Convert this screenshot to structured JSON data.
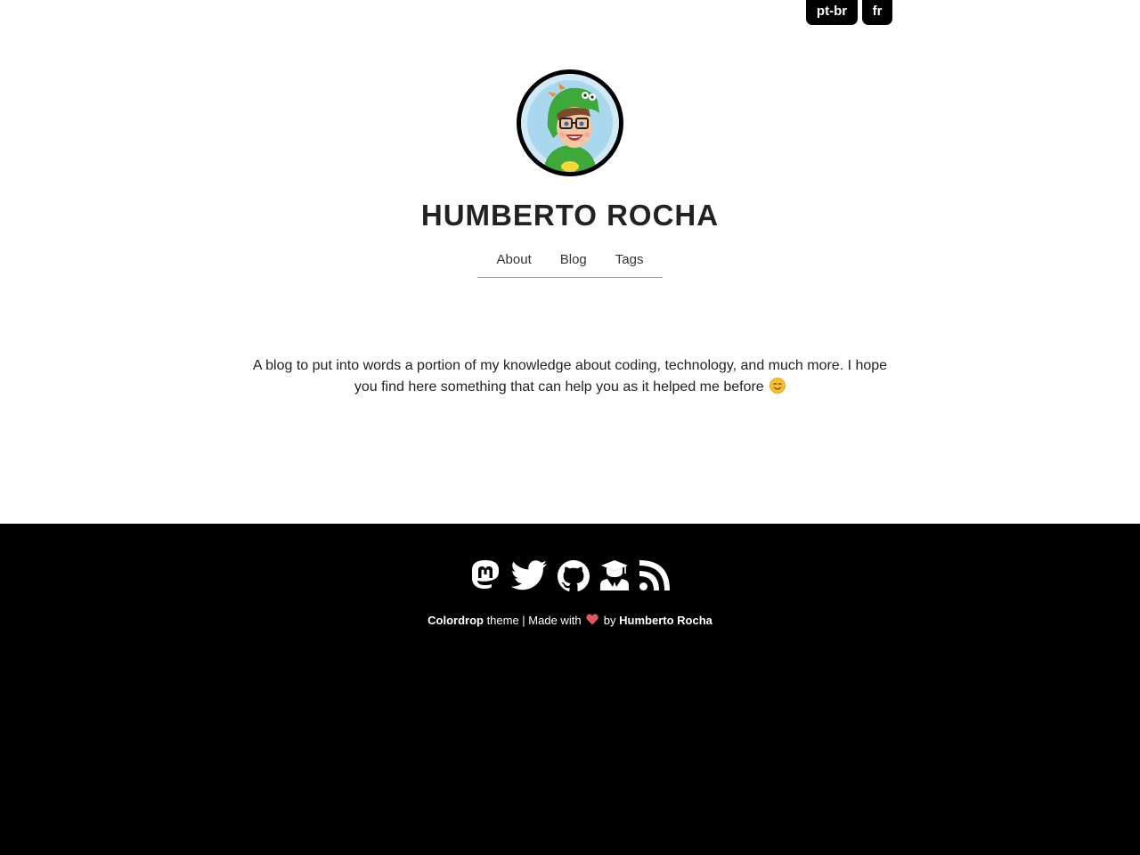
{
  "languages": [
    {
      "label": "pt-br"
    },
    {
      "label": "fr"
    }
  ],
  "header": {
    "site_title": "HUMBERTO ROCHA",
    "avatar_icon": "avatar-dino-costume"
  },
  "nav": {
    "items": [
      {
        "label": "About"
      },
      {
        "label": "Blog"
      },
      {
        "label": "Tags"
      }
    ]
  },
  "intro": {
    "text": "A blog to put into words a portion of my knowledge about coding, technology, and much more. I hope you find here something that can help you as it helped me before",
    "emoji": "smiling-face-icon"
  },
  "footer": {
    "social_icons": [
      "mastodon-icon",
      "twitter-icon",
      "github-icon",
      "scholar-icon",
      "rss-icon"
    ],
    "credits": {
      "theme_name": "Colordrop",
      "theme_suffix": " theme | Made with ",
      "by_text": " by ",
      "author": "Humberto Rocha"
    },
    "heart_color": "#e05560",
    "background": "#000000"
  }
}
